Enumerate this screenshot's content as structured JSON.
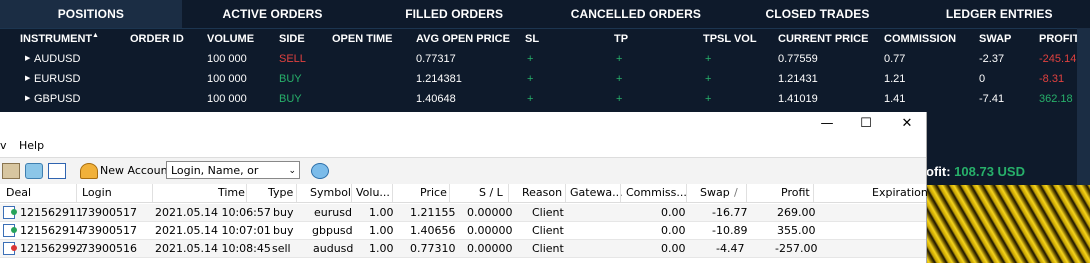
{
  "tabs": [
    "POSITIONS",
    "ACTIVE ORDERS",
    "FILLED ORDERS",
    "CANCELLED ORDERS",
    "CLOSED TRADES",
    "LEDGER ENTRIES"
  ],
  "positions": {
    "headers": {
      "instrument": "INSTRUMENT",
      "order_id": "ORDER ID",
      "volume": "VOLUME",
      "side": "SIDE",
      "open_time": "OPEN TIME",
      "avg_open_price": "AVG OPEN PRICE",
      "sl": "SL",
      "tp": "TP",
      "tpsl_vol": "TPSL VOL",
      "current_price": "CURRENT PRICE",
      "commission": "COMMISSION",
      "swap": "SWAP",
      "profit": "PROFIT"
    },
    "rows": [
      {
        "instrument": "AUDUSD",
        "volume": "100 000",
        "side": "SELL",
        "avg_open_price": "0.77317",
        "sl": "+",
        "tp": "+",
        "tpsl": "+",
        "current_price": "0.77559",
        "commission": "0.77",
        "swap": "-2.37",
        "profit": "-245.14"
      },
      {
        "instrument": "EURUSD",
        "volume": "100 000",
        "side": "BUY",
        "avg_open_price": "1.214381",
        "sl": "+",
        "tp": "+",
        "tpsl": "+",
        "current_price": "1.21431",
        "commission": "1.21",
        "swap": "0",
        "profit": "-8.31"
      },
      {
        "instrument": "GBPUSD",
        "volume": "100 000",
        "side": "BUY",
        "avg_open_price": "1.40648",
        "sl": "+",
        "tp": "+",
        "tpsl": "+",
        "current_price": "1.41019",
        "commission": "1.41",
        "swap": "-7.41",
        "profit": "362.18"
      }
    ],
    "profit_label": "ofit:",
    "profit_value": "108.73 USD"
  },
  "window": {
    "menu_help": "Help",
    "menu_partial": "v",
    "minimize": "—",
    "maximize": "☐",
    "close": "✕",
    "new_account": "New Account",
    "search_placeholder": "Login, Name, or #Order",
    "columns": [
      "Deal",
      "Login",
      "Time",
      "Type",
      "Symbol",
      "Volu...",
      "Price",
      "S / L",
      "Reason",
      "Gatewa...",
      "Commiss...",
      "Swap",
      "Profit",
      "Expiration"
    ],
    "swap_sort_indicator": "/",
    "deals": [
      {
        "deal": "121562911",
        "login": "73900517",
        "time": "2021.05.14 10:06:57",
        "type": "buy",
        "symbol": "eurusd",
        "volume": "1.00",
        "price": "1.21155",
        "sl": "0.00000",
        "reason": "Client",
        "gateway": "",
        "commission": "0.00",
        "swap": "-16.77",
        "profit": "269.00",
        "expiration": "",
        "icon_status": "#27a35a"
      },
      {
        "deal": "121562914",
        "login": "73900517",
        "time": "2021.05.14 10:07:01",
        "type": "buy",
        "symbol": "gbpusd",
        "volume": "1.00",
        "price": "1.40656",
        "sl": "0.00000",
        "reason": "Client",
        "gateway": "",
        "commission": "0.00",
        "swap": "-10.89",
        "profit": "355.00",
        "expiration": "",
        "icon_status": "#27a35a"
      },
      {
        "deal": "121562992",
        "login": "73900516",
        "time": "2021.05.14 10:08:45",
        "type": "sell",
        "symbol": "audusd",
        "volume": "1.00",
        "price": "0.77310",
        "sl": "0.00000",
        "reason": "Client",
        "gateway": "",
        "commission": "0.00",
        "swap": "-4.47",
        "profit": "-257.00",
        "expiration": "",
        "icon_status": "#d83333"
      }
    ]
  }
}
